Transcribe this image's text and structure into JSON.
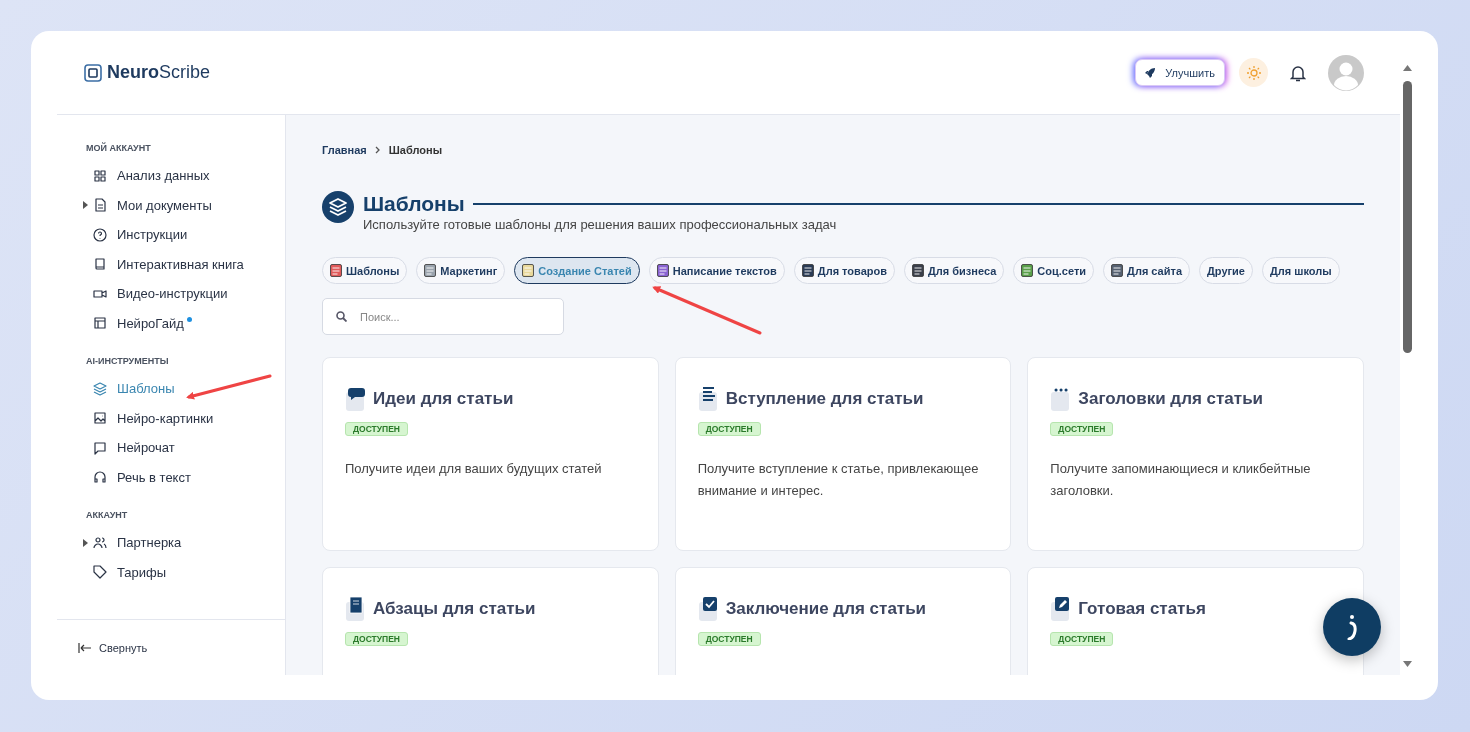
{
  "header": {
    "logo": "**Neuro**Scribe",
    "upgrade_button": "Улучшить"
  },
  "sidebar": {
    "sections": [
      {
        "title": "МОЙ АККАУНТ",
        "items": [
          {
            "label": "Анализ данных",
            "kind": "link",
            "selected": false,
            "new": false
          },
          {
            "label": "Мои документы",
            "kind": "group",
            "selected": false,
            "new": false
          },
          {
            "label": "Инструкции",
            "kind": "link",
            "selected": false,
            "new": false
          },
          {
            "label": "Интерактивная книга",
            "kind": "link",
            "selected": false,
            "new": false
          },
          {
            "label": "Видео-инструкции",
            "kind": "link",
            "selected": false,
            "new": false
          },
          {
            "label": "НейроГайд",
            "kind": "link",
            "selected": false,
            "new": true
          }
        ]
      },
      {
        "title": "AI-ИНСТРУМЕНТЫ",
        "items": [
          {
            "label": "Шаблоны",
            "kind": "link",
            "selected": true,
            "new": false
          },
          {
            "label": "Нейро-картинки",
            "kind": "link",
            "selected": false,
            "new": false
          },
          {
            "label": "Нейрочат",
            "kind": "link",
            "selected": false,
            "new": false
          },
          {
            "label": "Речь в текст",
            "kind": "link",
            "selected": false,
            "new": false
          }
        ]
      },
      {
        "title": "АККАУНТ",
        "items": [
          {
            "label": "Партнерка",
            "kind": "group",
            "selected": false,
            "new": false
          },
          {
            "label": "Тарифы",
            "kind": "link",
            "selected": false,
            "new": false
          }
        ]
      }
    ],
    "collapse": "Свернуть"
  },
  "breadcrumb": [
    "Главная",
    "Шаблоны"
  ],
  "page": {
    "title": "Шаблоны",
    "subtitle": "Используйте готовые шаблоны для решения ваших профессиональных задач"
  },
  "chips": [
    {
      "label": "Шаблоны",
      "selected": false
    },
    {
      "label": "Маркетинг",
      "selected": false
    },
    {
      "label": "Создание Статей",
      "selected": true
    },
    {
      "label": "Написание текстов",
      "selected": false
    },
    {
      "label": "Для товаров",
      "selected": false
    },
    {
      "label": "Для бизнеса",
      "selected": false
    },
    {
      "label": "Соц.сети",
      "selected": false
    },
    {
      "label": "Для сайта",
      "selected": false
    },
    {
      "label": "Другие",
      "selected": false
    },
    {
      "label": "Для школы",
      "selected": false
    }
  ],
  "search": {
    "placeholder": "Поиск..."
  },
  "cards": [
    {
      "title": "Идеи для статьи",
      "badge": "ДОСТУПЕН",
      "description": "Получите идеи для ваших будущих статей"
    },
    {
      "title": "Вступление для статьи",
      "badge": "ДОСТУПЕН",
      "description": "Получите вступление к статье, привлекающее внимание и интерес."
    },
    {
      "title": "Заголовки для статьи",
      "badge": "ДОСТУПЕН",
      "description": "Получите запоминающиеся и кликбейтные заголовки."
    },
    {
      "title": "Абзацы для статьи",
      "badge": "ДОСТУПЕН"
    },
    {
      "title": "Заключение для статьи",
      "badge": "ДОСТУПЕН"
    },
    {
      "title": "Готовая статья",
      "badge": "ДОСТУПЕН"
    }
  ]
}
